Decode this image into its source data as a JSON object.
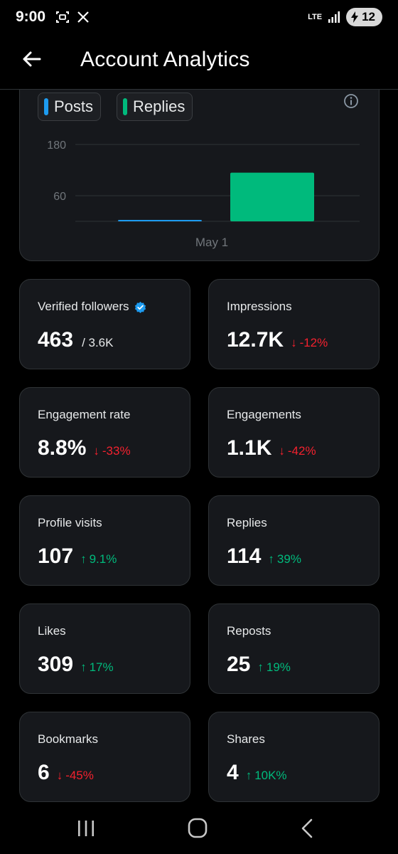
{
  "status_bar": {
    "time": "9:00",
    "network": "LTE",
    "battery": "12",
    "icons": [
      "screenshot-icon",
      "x-logo-icon",
      "signal-icon",
      "battery-charging-icon"
    ]
  },
  "header": {
    "title": "Account Analytics",
    "back_icon": "arrow-left-icon"
  },
  "chart": {
    "legend": [
      {
        "label": "Posts",
        "color": "#1d9bf0"
      },
      {
        "label": "Replies",
        "color": "#00ba7c"
      }
    ],
    "info_icon": "info-circle-icon"
  },
  "chart_data": {
    "type": "bar",
    "categories": [
      "May 1"
    ],
    "series": [
      {
        "name": "Posts",
        "values": [
          1
        ],
        "color": "#1d9bf0"
      },
      {
        "name": "Replies",
        "values": [
          114
        ],
        "color": "#00ba7c"
      }
    ],
    "yticks": [
      "180",
      "60"
    ],
    "ytick_values": [
      180,
      60
    ],
    "ylim": [
      0,
      200
    ]
  },
  "stats": [
    {
      "label": "Verified followers",
      "value": "463",
      "sub": "/ 3.6K",
      "verified": true
    },
    {
      "label": "Impressions",
      "value": "12.7K",
      "delta": "-12%",
      "direction": "down"
    },
    {
      "label": "Engagement rate",
      "value": "8.8%",
      "delta": "-33%",
      "direction": "down"
    },
    {
      "label": "Engagements",
      "value": "1.1K",
      "delta": "-42%",
      "direction": "down"
    },
    {
      "label": "Profile visits",
      "value": "107",
      "delta": "9.1%",
      "direction": "up"
    },
    {
      "label": "Replies",
      "value": "114",
      "delta": "39%",
      "direction": "up"
    },
    {
      "label": "Likes",
      "value": "309",
      "delta": "17%",
      "direction": "up"
    },
    {
      "label": "Reposts",
      "value": "25",
      "delta": "19%",
      "direction": "up"
    },
    {
      "label": "Bookmarks",
      "value": "6",
      "delta": "-45%",
      "direction": "down"
    },
    {
      "label": "Shares",
      "value": "4",
      "delta": "10K%",
      "direction": "up"
    }
  ],
  "arrows": {
    "up": "↑",
    "down": "↓"
  },
  "nav": {
    "icons": [
      "recent-apps-icon",
      "home-icon",
      "back-icon"
    ]
  }
}
